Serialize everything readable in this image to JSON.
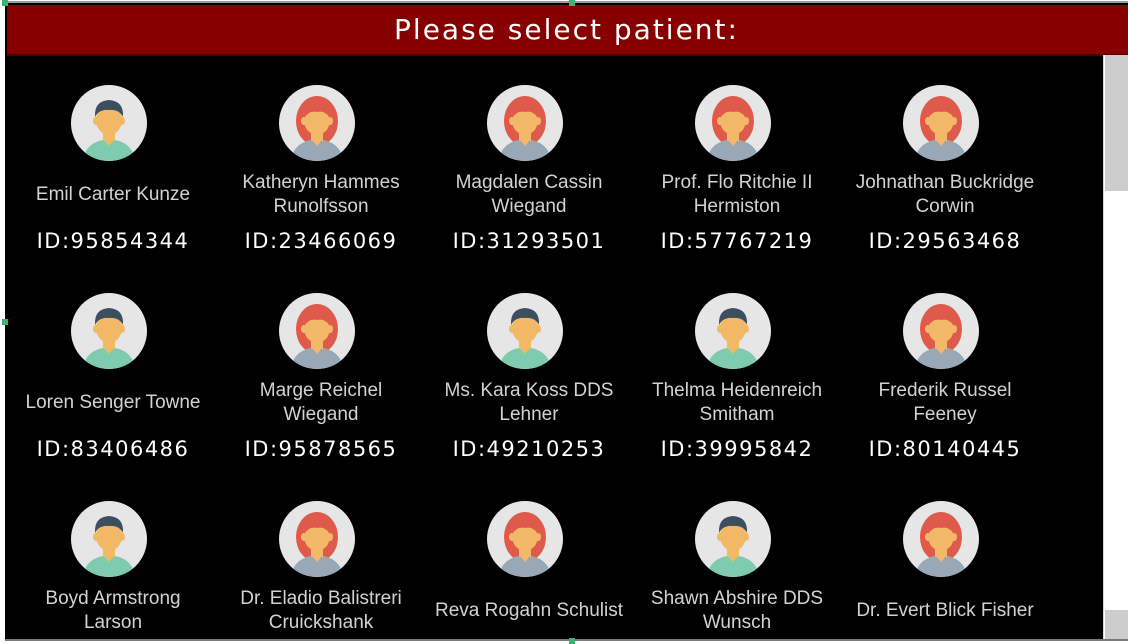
{
  "header": {
    "title": "Please select patient:"
  },
  "colors": {
    "header_bg": "#870000",
    "list_bg": "#000000",
    "name_text": "#d2d2d2",
    "id_text": "#ffffff",
    "avatar_circle": "#e6e6e6",
    "male_hair": "#3d4e5c",
    "female_hair": "#e05a4b",
    "skin": "#f2b767",
    "male_shirt": "#7ecbae",
    "female_shirt": "#9aa8b5"
  },
  "patients": [
    {
      "name": "Emil Carter Kunze",
      "id": "ID:95854344",
      "avatar": "male-avatar-icon"
    },
    {
      "name": "Katheryn Hammes Runolfsson",
      "id": "ID:23466069",
      "avatar": "female-avatar-icon"
    },
    {
      "name": "Magdalen Cassin Wiegand",
      "id": "ID:31293501",
      "avatar": "female-avatar-icon"
    },
    {
      "name": "Prof. Flo Ritchie II Hermiston",
      "id": "ID:57767219",
      "avatar": "female-avatar-icon"
    },
    {
      "name": "Johnathan Buckridge Corwin",
      "id": "ID:29563468",
      "avatar": "female-avatar-icon"
    },
    {
      "name": "Loren Senger Towne",
      "id": "ID:83406486",
      "avatar": "male-avatar-icon"
    },
    {
      "name": "Marge Reichel Wiegand",
      "id": "ID:95878565",
      "avatar": "female-avatar-icon"
    },
    {
      "name": "Ms. Kara Koss DDS Lehner",
      "id": "ID:49210253",
      "avatar": "male-avatar-icon"
    },
    {
      "name": "Thelma Heidenreich Smitham",
      "id": "ID:39995842",
      "avatar": "male-avatar-icon"
    },
    {
      "name": "Frederik Russel Feeney",
      "id": "ID:80140445",
      "avatar": "female-avatar-icon"
    },
    {
      "name": "Boyd Armstrong Larson",
      "id": "",
      "avatar": "male-avatar-icon"
    },
    {
      "name": "Dr. Eladio Balistreri Cruickshank",
      "id": "",
      "avatar": "female-avatar-icon"
    },
    {
      "name": "Reva Rogahn Schulist",
      "id": "",
      "avatar": "female-avatar-icon"
    },
    {
      "name": "Shawn Abshire DDS Wunsch",
      "id": "",
      "avatar": "male-avatar-icon"
    },
    {
      "name": "Dr. Evert Blick Fisher",
      "id": "",
      "avatar": "female-avatar-icon"
    }
  ]
}
